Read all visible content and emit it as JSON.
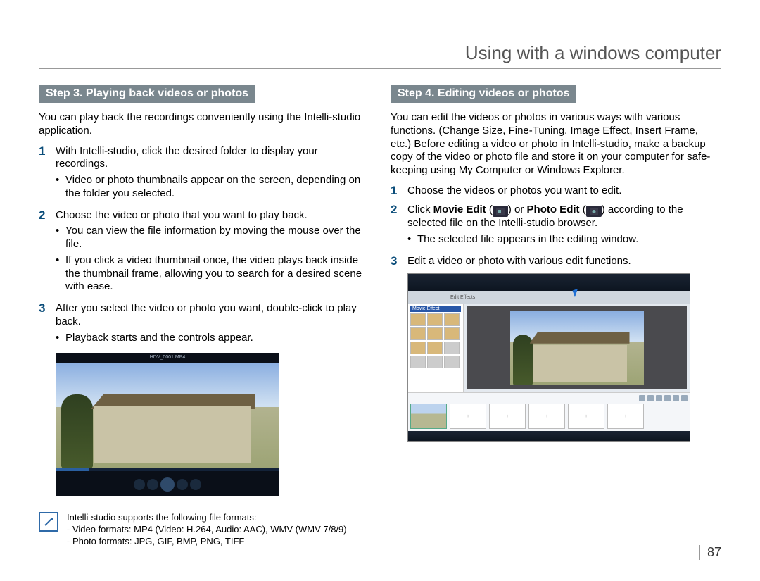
{
  "header": {
    "title": "Using with a windows computer"
  },
  "page_number": "87",
  "left": {
    "step_bar": "Step 3. Playing back videos or photos",
    "intro": "You can play back the recordings conveniently using the Intelli-studio application.",
    "items": [
      {
        "num": "1",
        "text": "With Intelli-studio, click the desired folder to display your recordings.",
        "bullets": [
          "Video or photo thumbnails appear on the screen, depending on the folder you selected."
        ]
      },
      {
        "num": "2",
        "text": "Choose the video or photo that you want to play back.",
        "bullets": [
          "You can view the file information by moving the mouse over the file.",
          "If you click a video thumbnail once, the video plays back inside the thumbnail frame, allowing you to search for a desired scene with ease."
        ]
      },
      {
        "num": "3",
        "text": "After you select the video or photo you want, double-click to play back.",
        "bullets": [
          "Playback starts and the controls appear."
        ]
      }
    ],
    "player_caption": "HDV_0001.MP4",
    "note": {
      "l1": "Intelli-studio supports the following file formats:",
      "l2": "- Video formats: MP4 (Video: H.264, Audio: AAC), WMV (WMV 7/8/9)",
      "l3": "- Photo formats: JPG, GIF, BMP, PNG, TIFF"
    }
  },
  "right": {
    "step_bar": "Step 4. Editing videos or photos",
    "intro": "You can edit the videos or photos in various ways with various functions. (Change Size, Fine-Tuning, Image Effect, Insert Frame, etc.) Before editing a video or photo in Intelli-studio, make a backup copy of the video or photo file and store it on your computer for safe-keeping using My Computer or Windows Explorer.",
    "items": [
      {
        "num": "1",
        "text_html": "Choose the videos or photos you want to edit."
      },
      {
        "num": "2",
        "pre": "Click ",
        "b1": "Movie Edit",
        "mid1": " (",
        "icon1": "movie-edit-icon",
        "mid2": ") or ",
        "b2": "Photo Edit",
        "mid3": " (",
        "icon2": "photo-edit-icon",
        "post": ") according to the selected file on the Intelli-studio browser.",
        "bullets": [
          "The selected file appears in the editing window."
        ]
      },
      {
        "num": "3",
        "text_html": "Edit a video or photo with various edit functions."
      }
    ],
    "editor": {
      "fx_title": "Movie Effect",
      "tabs": [
        "Edit Effects"
      ]
    }
  }
}
